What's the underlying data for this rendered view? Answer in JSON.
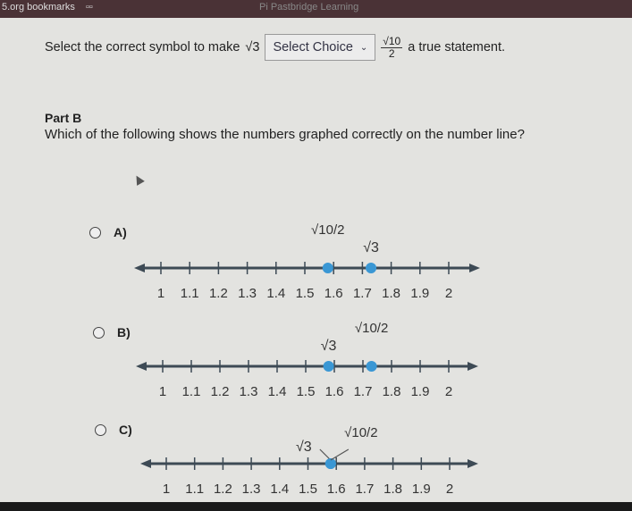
{
  "browser": {
    "bookmarks": "5.org bookmarks",
    "tab": "Pi Pastbridge Learning"
  },
  "question1": {
    "prefix": "Select the correct symbol to make",
    "left": "√3",
    "select_value": "Select Choice",
    "right_num": "√10",
    "right_den": "2",
    "suffix": "a true statement."
  },
  "partB": {
    "title": "Part B",
    "question": "Which of the following shows the numbers graphed correctly on the number line?"
  },
  "options": [
    {
      "label": "A)",
      "points": [
        {
          "value": 1.58,
          "label": "√10/2"
        },
        {
          "value": 1.73,
          "label": "√3"
        }
      ]
    },
    {
      "label": "B)",
      "points": [
        {
          "value": 1.58,
          "label": "√3"
        },
        {
          "value": 1.73,
          "label": "√10/2"
        }
      ]
    },
    {
      "label": "C)",
      "points": [
        {
          "value": 1.58,
          "label": "√3"
        },
        {
          "value": 1.58,
          "label": "√10/2"
        }
      ]
    }
  ],
  "ticks": [
    "1",
    "1.1",
    "1.2",
    "1.3",
    "1.4",
    "1.5",
    "1.6",
    "1.7",
    "1.8",
    "1.9",
    "2"
  ],
  "colors": {
    "line": "#3d4a55",
    "dot": "#3a97d4"
  }
}
